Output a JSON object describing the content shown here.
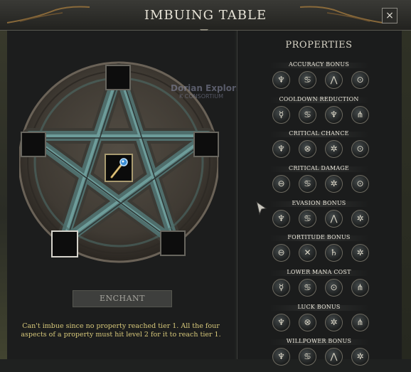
{
  "window": {
    "title": "IMBUING TABLE",
    "close_glyph": "×"
  },
  "enchant": {
    "slot_icons": [
      "empty-slot",
      "empty-slot",
      "empty-slot",
      "empty-slot",
      "empty-slot"
    ],
    "center_item": "staff-item-icon",
    "button_label": "ENCHANT",
    "message": "Can't imbue since no property reached tier 1. All the four aspects of a property must hit level 2 for it to reach tier 1."
  },
  "background_text": {
    "name": "Dorian Explorian",
    "guild": "K CONSORTIUM"
  },
  "properties": {
    "title": "PROPERTIES",
    "groups": [
      {
        "label": "ACCURACY BONUS",
        "runes": [
          "♆",
          "♋",
          "⋀",
          "⊙"
        ]
      },
      {
        "label": "COOLDOWN REDUCTION",
        "runes": [
          "☿",
          "♋",
          "♆",
          "⋔"
        ]
      },
      {
        "label": "CRITICAL CHANCE",
        "runes": [
          "♆",
          "⊗",
          "✲",
          "⊙"
        ]
      },
      {
        "label": "CRITICAL DAMAGE",
        "runes": [
          "⊖",
          "♋",
          "✲",
          "⊙"
        ]
      },
      {
        "label": "EVASION BONUS",
        "runes": [
          "♆",
          "♋",
          "⋀",
          "✲"
        ]
      },
      {
        "label": "FORTITUDE BONUS",
        "runes": [
          "⊖",
          "✕",
          "♄",
          "✲"
        ]
      },
      {
        "label": "LOWER MANA COST",
        "runes": [
          "☿",
          "♋",
          "⊙",
          "⋔"
        ]
      },
      {
        "label": "LUCK BONUS",
        "runes": [
          "♆",
          "⊗",
          "✲",
          "⋔"
        ]
      },
      {
        "label": "WILLPOWER BONUS",
        "runes": [
          "♆",
          "♋",
          "⋀",
          "✲"
        ]
      }
    ]
  },
  "colors": {
    "accent_gold": "#d7c87a",
    "frame": "#67655e"
  }
}
